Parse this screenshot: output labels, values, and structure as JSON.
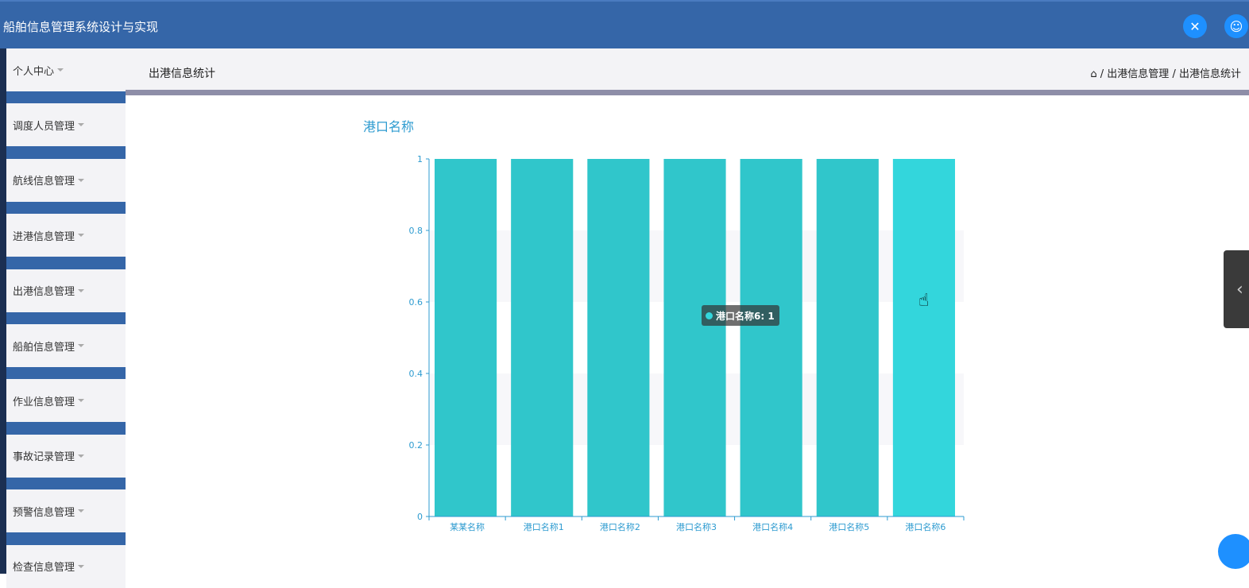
{
  "header": {
    "title": "船舶信息管理系统设计与实现"
  },
  "sidebar": {
    "items": [
      {
        "label": "个人中心"
      },
      {
        "label": "调度人员管理"
      },
      {
        "label": "航线信息管理"
      },
      {
        "label": "进港信息管理"
      },
      {
        "label": "出港信息管理"
      },
      {
        "label": "船舶信息管理"
      },
      {
        "label": "作业信息管理"
      },
      {
        "label": "事故记录管理"
      },
      {
        "label": "预警信息管理"
      },
      {
        "label": "检查信息管理"
      }
    ]
  },
  "page": {
    "title": "出港信息统计",
    "breadcrumb": [
      "出港信息管理",
      "出港信息统计"
    ],
    "sep": "/"
  },
  "tooltip": {
    "text": "港口名称6: 1"
  },
  "colors": {
    "bar": "#30c6cb",
    "bar_hover": "#33d6dc",
    "axis": "#2d9bd0"
  },
  "chart_data": {
    "type": "bar",
    "title": "港口名称",
    "categories": [
      "某某名称",
      "港口名称1",
      "港口名称2",
      "港口名称3",
      "港口名称4",
      "港口名称5",
      "港口名称6"
    ],
    "values": [
      1,
      1,
      1,
      1,
      1,
      1,
      1
    ],
    "yticks": [
      "0",
      "0.2",
      "0.4",
      "0.6",
      "0.8",
      "1"
    ],
    "ylim": [
      0,
      1
    ],
    "grid": true,
    "highlighted": "港口名称6"
  }
}
